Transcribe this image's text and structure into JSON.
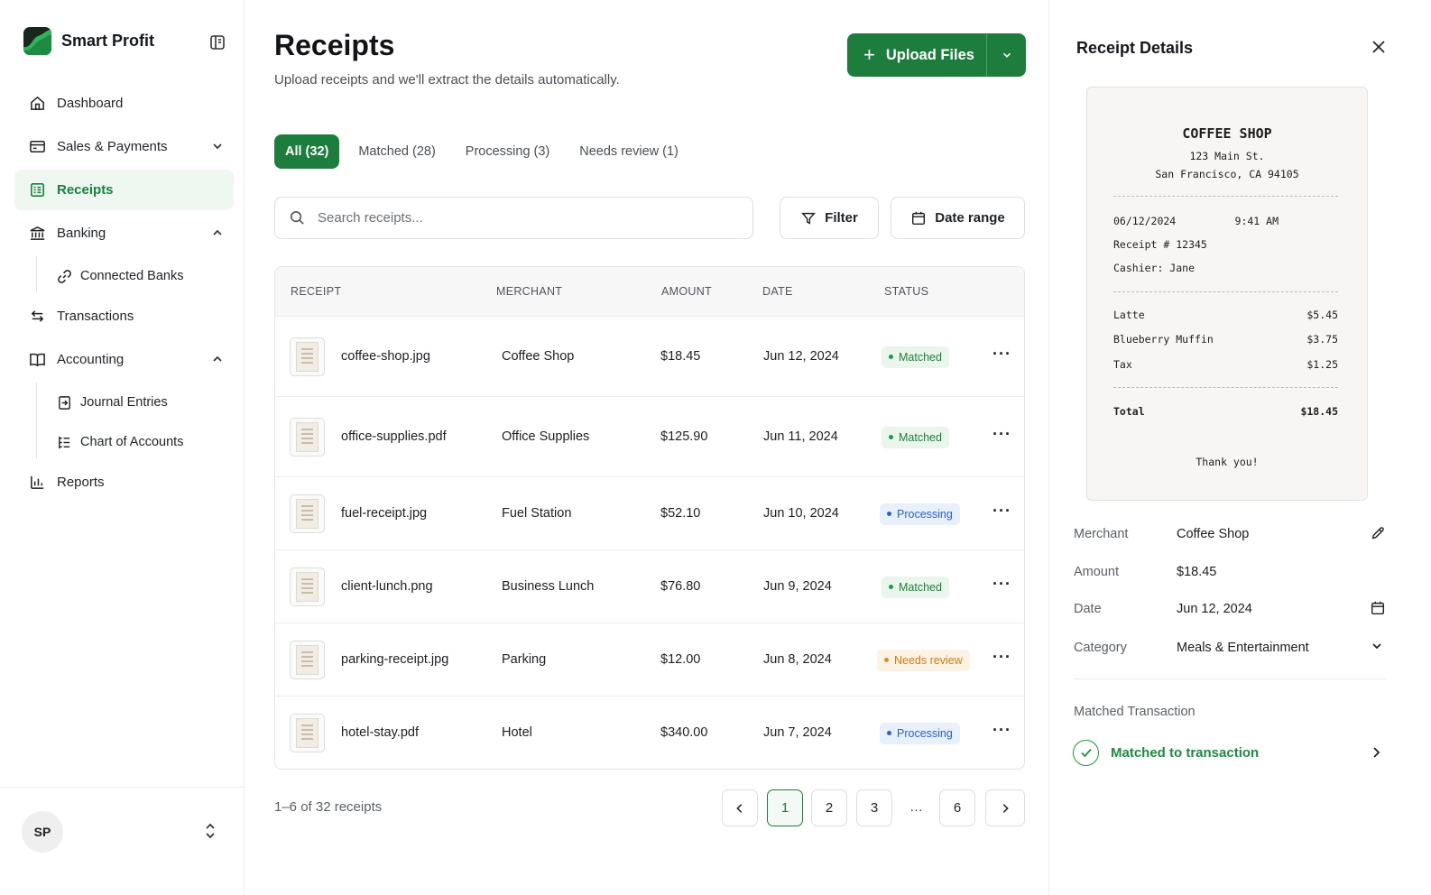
{
  "brand": {
    "name": "Smart Profit"
  },
  "sidebar": {
    "items": [
      {
        "label": "Dashboard",
        "icon": "home-icon"
      },
      {
        "label": "Sales & Payments",
        "icon": "card-icon",
        "chevron": "down"
      },
      {
        "label": "Receipts",
        "icon": "receipt-icon",
        "active": true
      },
      {
        "label": "Banking",
        "icon": "bank-icon",
        "chevron": "up"
      },
      {
        "label": "Connected Banks",
        "icon": "link-icon",
        "sub": true
      },
      {
        "label": "Transactions",
        "icon": "arrows-icon"
      },
      {
        "label": "Accounting",
        "icon": "book-icon",
        "chevron": "up"
      },
      {
        "label": "Journal Entries",
        "icon": "journal-icon",
        "sub": true
      },
      {
        "label": "Chart of Accounts",
        "icon": "list-tree-icon",
        "sub": true
      },
      {
        "label": "Reports",
        "icon": "bar-chart-icon"
      }
    ],
    "user_initials": "SP"
  },
  "main": {
    "title": "Receipts",
    "subtitle": "Upload receipts and we'll extract the details automatically.",
    "upload_label": "Upload Files",
    "tabs": [
      {
        "label": "All (32)",
        "active": true
      },
      {
        "label": "Matched (28)"
      },
      {
        "label": "Processing (3)"
      },
      {
        "label": "Needs review (1)"
      }
    ],
    "search_placeholder": "Search receipts...",
    "filter_label": "Filter",
    "date_range_label": "Date range",
    "columns": {
      "receipt": "RECEIPT",
      "merchant": "MERCHANT",
      "amount": "AMOUNT",
      "date": "DATE",
      "status": "STATUS"
    },
    "rows": [
      {
        "file": "coffee-shop.jpg",
        "merchant": "Coffee Shop",
        "amount": "$18.45",
        "date": "Jun 12, 2024",
        "status": "Matched",
        "kind": "matched"
      },
      {
        "file": "office-supplies.pdf",
        "merchant": "Office Supplies",
        "amount": "$125.90",
        "date": "Jun 11, 2024",
        "status": "Matched",
        "kind": "matched"
      },
      {
        "file": "fuel-receipt.jpg",
        "merchant": "Fuel Station",
        "amount": "$52.10",
        "date": "Jun 10, 2024",
        "status": "Processing",
        "kind": "processing"
      },
      {
        "file": "client-lunch.png",
        "merchant": "Business Lunch",
        "amount": "$76.80",
        "date": "Jun 9, 2024",
        "status": "Matched",
        "kind": "matched"
      },
      {
        "file": "parking-receipt.jpg",
        "merchant": "Parking",
        "amount": "$12.00",
        "date": "Jun 8, 2024",
        "status": "Needs review",
        "kind": "review"
      },
      {
        "file": "hotel-stay.pdf",
        "merchant": "Hotel",
        "amount": "$340.00",
        "date": "Jun 7, 2024",
        "status": "Processing",
        "kind": "processing"
      }
    ],
    "count_text": "1–6 of 32 receipts",
    "pages": [
      "1",
      "2",
      "3",
      "…",
      "6"
    ]
  },
  "details": {
    "title": "Receipt Details",
    "receipt": {
      "shop": "COFFEE SHOP",
      "address1": "123 Main St.",
      "address2": "San Francisco, CA 94105",
      "date": "06/12/2024",
      "time": "9:41 AM",
      "number": "Receipt # 12345",
      "cashier": "Cashier: Jane",
      "items": [
        {
          "name": "Latte",
          "price": "$5.45"
        },
        {
          "name": "Blueberry Muffin",
          "price": "$3.75"
        },
        {
          "name": "Tax",
          "price": "$1.25"
        }
      ],
      "total_label": "Total",
      "total": "$18.45",
      "thanks": "Thank you!"
    },
    "fields": {
      "merchant_label": "Merchant",
      "merchant": "Coffee Shop",
      "amount_label": "Amount",
      "amount": "$18.45",
      "date_label": "Date",
      "date": "Jun 12, 2024",
      "category_label": "Category",
      "category": "Meals & Entertainment"
    },
    "matched_label": "Matched Transaction",
    "matched_text": "Matched to transaction"
  },
  "colors": {
    "accent": "#1c7d3d",
    "matched": "#1f9a48",
    "processing": "#2b62c9",
    "review": "#e08b1e"
  }
}
